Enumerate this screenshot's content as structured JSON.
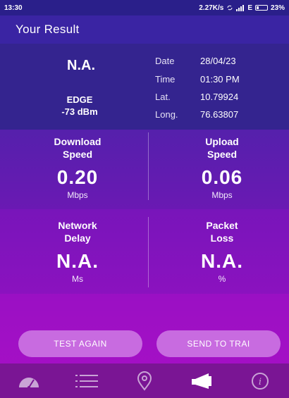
{
  "status_bar": {
    "time": "13:30",
    "speed": "2.27K/s",
    "network": "E",
    "battery_label": "23%",
    "battery_level": 0.23
  },
  "header": {
    "title": "Your Result"
  },
  "info": {
    "network_value": "N.A.",
    "network_type": "EDGE",
    "signal": "-73 dBm",
    "meta": [
      {
        "label": "Date",
        "value": "28/04/23"
      },
      {
        "label": "Time",
        "value": "01:30 PM"
      },
      {
        "label": "Lat.",
        "value": "10.79924"
      },
      {
        "label": "Long.",
        "value": "76.63807"
      }
    ]
  },
  "metrics": {
    "download": {
      "title_line1": "Download",
      "title_line2": "Speed",
      "value": "0.20",
      "unit": "Mbps"
    },
    "upload": {
      "title_line1": "Upload",
      "title_line2": "Speed",
      "value": "0.06",
      "unit": "Mbps"
    },
    "delay": {
      "title_line1": "Network",
      "title_line2": "Delay",
      "value": "N.A.",
      "unit": "Ms"
    },
    "loss": {
      "title_line1": "Packet",
      "title_line2": "Loss",
      "value": "N.A.",
      "unit": "%"
    }
  },
  "buttons": {
    "test_again": "TEST AGAIN",
    "send": "SEND TO TRAI"
  },
  "bottom_nav": [
    {
      "icon": "speedometer-icon"
    },
    {
      "icon": "menu-icon"
    },
    {
      "icon": "location-pin-icon"
    },
    {
      "icon": "megaphone-icon",
      "active": true
    },
    {
      "icon": "info-icon"
    }
  ],
  "colors": {
    "header": "#3a24a3",
    "button": "#c86be0",
    "nav": "#7a1594"
  }
}
